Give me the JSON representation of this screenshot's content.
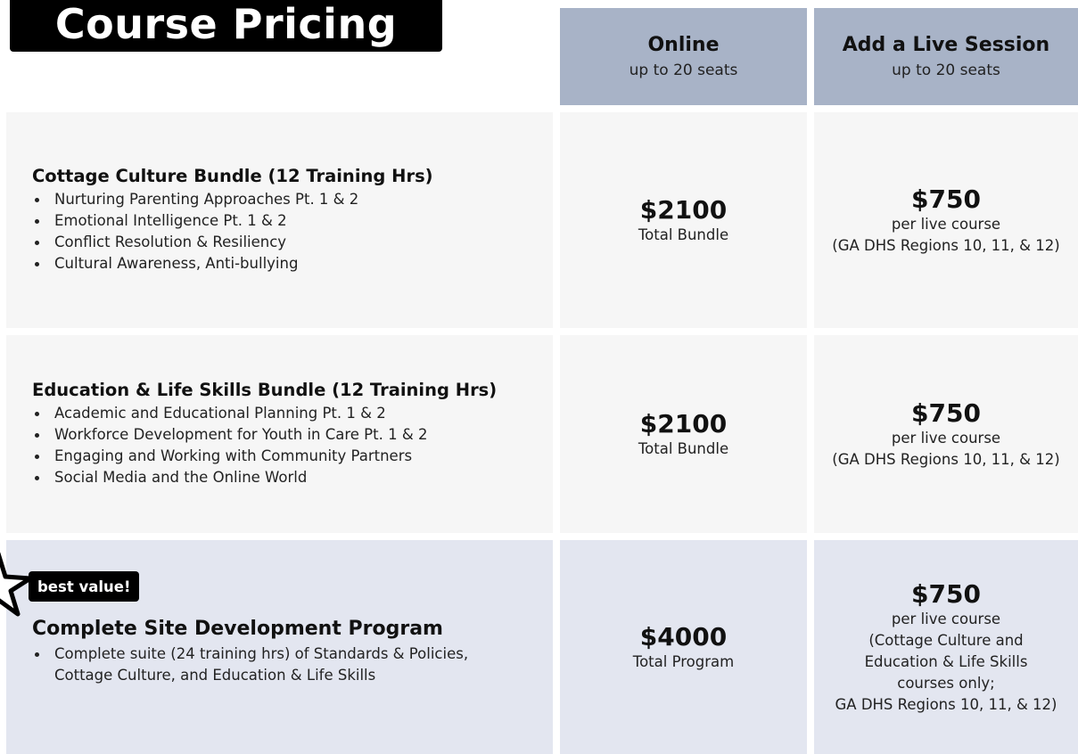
{
  "title": "Course Pricing",
  "columns": [
    {
      "title": "Online",
      "subtitle": "up to 20 seats"
    },
    {
      "title": "Add a Live Session",
      "subtitle": "up to 20 seats"
    }
  ],
  "rows": [
    {
      "title": "Cottage Culture Bundle (12 Training Hrs)",
      "items": [
        "Nurturing Parenting Approaches  Pt. 1 & 2",
        "Emotional Intelligence Pt. 1 & 2",
        "Conflict Resolution & Resiliency",
        "Cultural Awareness, Anti-bullying"
      ],
      "online_price": "$2100",
      "online_note": "Total Bundle",
      "live_price": "$750",
      "live_notes": [
        "per live course",
        "(GA DHS Regions 10, 11, & 12)"
      ]
    },
    {
      "title": "Education & Life Skills Bundle (12 Training Hrs)",
      "items": [
        "Academic and Educational Planning Pt. 1 & 2",
        "Workforce Development for Youth in Care Pt. 1 & 2",
        "Engaging and Working with Community Partners",
        "Social Media and the Online World"
      ],
      "online_price": "$2100",
      "online_note": "Total Bundle",
      "live_price": "$750",
      "live_notes": [
        "per live course",
        "(GA DHS Regions 10, 11, & 12)"
      ]
    },
    {
      "badge": "best value!",
      "title": "Complete Site Development Program",
      "items": [
        "Complete suite (24 training hrs) of Standards & Policies,",
        "Cottage Culture, and Education & Life Skills"
      ],
      "online_price": "$4000",
      "online_note": "Total Program",
      "live_price": "$750",
      "live_notes": [
        "per live course",
        "(Cottage Culture and",
        "Education & Life Skills",
        "courses only;",
        "GA DHS Regions 10, 11, & 12)"
      ]
    }
  ]
}
